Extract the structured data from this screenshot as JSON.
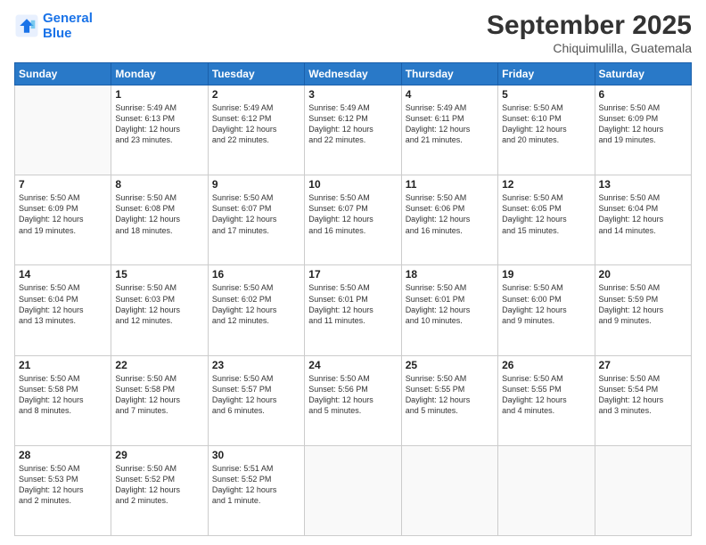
{
  "logo": {
    "line1": "General",
    "line2": "Blue"
  },
  "header": {
    "month": "September 2025",
    "location": "Chiquimulilla, Guatemala"
  },
  "weekdays": [
    "Sunday",
    "Monday",
    "Tuesday",
    "Wednesday",
    "Thursday",
    "Friday",
    "Saturday"
  ],
  "weeks": [
    [
      {
        "day": "",
        "info": ""
      },
      {
        "day": "1",
        "info": "Sunrise: 5:49 AM\nSunset: 6:13 PM\nDaylight: 12 hours\nand 23 minutes."
      },
      {
        "day": "2",
        "info": "Sunrise: 5:49 AM\nSunset: 6:12 PM\nDaylight: 12 hours\nand 22 minutes."
      },
      {
        "day": "3",
        "info": "Sunrise: 5:49 AM\nSunset: 6:12 PM\nDaylight: 12 hours\nand 22 minutes."
      },
      {
        "day": "4",
        "info": "Sunrise: 5:49 AM\nSunset: 6:11 PM\nDaylight: 12 hours\nand 21 minutes."
      },
      {
        "day": "5",
        "info": "Sunrise: 5:50 AM\nSunset: 6:10 PM\nDaylight: 12 hours\nand 20 minutes."
      },
      {
        "day": "6",
        "info": "Sunrise: 5:50 AM\nSunset: 6:09 PM\nDaylight: 12 hours\nand 19 minutes."
      }
    ],
    [
      {
        "day": "7",
        "info": "Sunrise: 5:50 AM\nSunset: 6:09 PM\nDaylight: 12 hours\nand 19 minutes."
      },
      {
        "day": "8",
        "info": "Sunrise: 5:50 AM\nSunset: 6:08 PM\nDaylight: 12 hours\nand 18 minutes."
      },
      {
        "day": "9",
        "info": "Sunrise: 5:50 AM\nSunset: 6:07 PM\nDaylight: 12 hours\nand 17 minutes."
      },
      {
        "day": "10",
        "info": "Sunrise: 5:50 AM\nSunset: 6:07 PM\nDaylight: 12 hours\nand 16 minutes."
      },
      {
        "day": "11",
        "info": "Sunrise: 5:50 AM\nSunset: 6:06 PM\nDaylight: 12 hours\nand 16 minutes."
      },
      {
        "day": "12",
        "info": "Sunrise: 5:50 AM\nSunset: 6:05 PM\nDaylight: 12 hours\nand 15 minutes."
      },
      {
        "day": "13",
        "info": "Sunrise: 5:50 AM\nSunset: 6:04 PM\nDaylight: 12 hours\nand 14 minutes."
      }
    ],
    [
      {
        "day": "14",
        "info": "Sunrise: 5:50 AM\nSunset: 6:04 PM\nDaylight: 12 hours\nand 13 minutes."
      },
      {
        "day": "15",
        "info": "Sunrise: 5:50 AM\nSunset: 6:03 PM\nDaylight: 12 hours\nand 12 minutes."
      },
      {
        "day": "16",
        "info": "Sunrise: 5:50 AM\nSunset: 6:02 PM\nDaylight: 12 hours\nand 12 minutes."
      },
      {
        "day": "17",
        "info": "Sunrise: 5:50 AM\nSunset: 6:01 PM\nDaylight: 12 hours\nand 11 minutes."
      },
      {
        "day": "18",
        "info": "Sunrise: 5:50 AM\nSunset: 6:01 PM\nDaylight: 12 hours\nand 10 minutes."
      },
      {
        "day": "19",
        "info": "Sunrise: 5:50 AM\nSunset: 6:00 PM\nDaylight: 12 hours\nand 9 minutes."
      },
      {
        "day": "20",
        "info": "Sunrise: 5:50 AM\nSunset: 5:59 PM\nDaylight: 12 hours\nand 9 minutes."
      }
    ],
    [
      {
        "day": "21",
        "info": "Sunrise: 5:50 AM\nSunset: 5:58 PM\nDaylight: 12 hours\nand 8 minutes."
      },
      {
        "day": "22",
        "info": "Sunrise: 5:50 AM\nSunset: 5:58 PM\nDaylight: 12 hours\nand 7 minutes."
      },
      {
        "day": "23",
        "info": "Sunrise: 5:50 AM\nSunset: 5:57 PM\nDaylight: 12 hours\nand 6 minutes."
      },
      {
        "day": "24",
        "info": "Sunrise: 5:50 AM\nSunset: 5:56 PM\nDaylight: 12 hours\nand 5 minutes."
      },
      {
        "day": "25",
        "info": "Sunrise: 5:50 AM\nSunset: 5:55 PM\nDaylight: 12 hours\nand 5 minutes."
      },
      {
        "day": "26",
        "info": "Sunrise: 5:50 AM\nSunset: 5:55 PM\nDaylight: 12 hours\nand 4 minutes."
      },
      {
        "day": "27",
        "info": "Sunrise: 5:50 AM\nSunset: 5:54 PM\nDaylight: 12 hours\nand 3 minutes."
      }
    ],
    [
      {
        "day": "28",
        "info": "Sunrise: 5:50 AM\nSunset: 5:53 PM\nDaylight: 12 hours\nand 2 minutes."
      },
      {
        "day": "29",
        "info": "Sunrise: 5:50 AM\nSunset: 5:52 PM\nDaylight: 12 hours\nand 2 minutes."
      },
      {
        "day": "30",
        "info": "Sunrise: 5:51 AM\nSunset: 5:52 PM\nDaylight: 12 hours\nand 1 minute."
      },
      {
        "day": "",
        "info": ""
      },
      {
        "day": "",
        "info": ""
      },
      {
        "day": "",
        "info": ""
      },
      {
        "day": "",
        "info": ""
      }
    ]
  ]
}
